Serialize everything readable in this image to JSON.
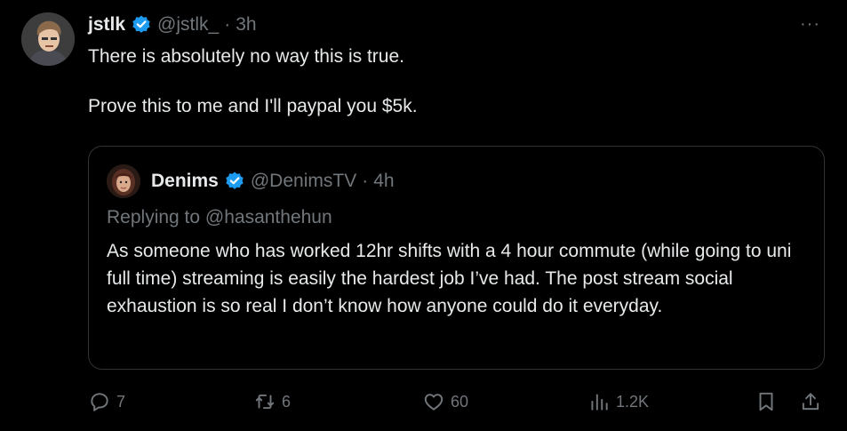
{
  "author": {
    "name": "jstlk",
    "handle": "@jstlk_",
    "separator": "·",
    "time": "3h",
    "more_label": "···"
  },
  "post": {
    "lines": [
      "There is absolutely no way this is true.",
      "Prove this to me and I'll paypal you $5k."
    ]
  },
  "quote": {
    "name": "Denims",
    "handle": "@DenimsTV",
    "separator": "·",
    "time": "4h",
    "replying_to": "Replying to @hasanthehun",
    "text": "As someone who has worked 12hr shifts with a 4 hour commute (while going to uni full time) streaming is easily the hardest job I’ve had. The post stream social exhaustion is so real I don’t know how anyone could do it everyday."
  },
  "actions": {
    "replies": "7",
    "reposts": "6",
    "likes": "60",
    "views": "1.2K"
  },
  "colors": {
    "verified": "#1d9bf0",
    "muted": "#71767b",
    "border": "#2f3336",
    "text": "#e7e9ea"
  }
}
